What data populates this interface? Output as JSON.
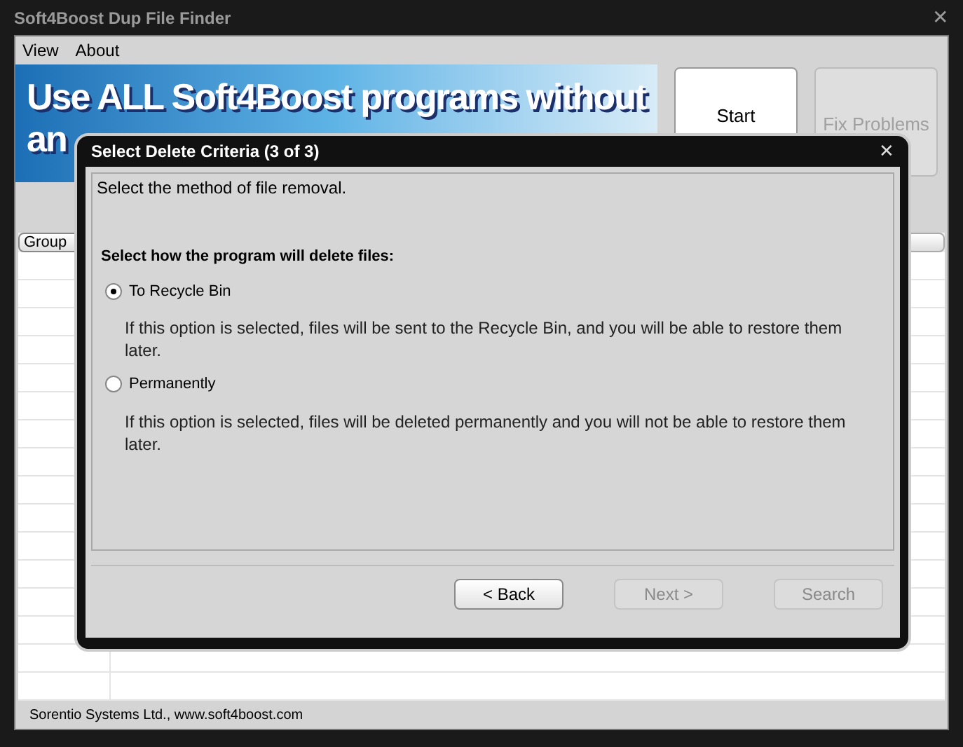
{
  "window": {
    "title": "Soft4Boost Dup File Finder",
    "close": "✕"
  },
  "menu": [
    {
      "label": "View"
    },
    {
      "label": "About"
    }
  ],
  "banner": {
    "lines": [
      "Use ALL Soft4Boost programs without",
      "an"
    ]
  },
  "toolbar": [
    {
      "label": "Start",
      "disabled": false
    },
    {
      "label": "Fix Problems",
      "disabled": true
    }
  ],
  "table": {
    "columns": [
      "Group"
    ]
  },
  "status_bar": "Sorentio Systems Ltd., www.soft4boost.com",
  "dialog": {
    "title": "Select Delete Criteria (3 of 3)",
    "close": "✕",
    "intro": "Select the method of file removal.",
    "heading": "Select how the program will delete files:",
    "options": [
      {
        "label": "To Recycle Bin",
        "selected": true,
        "description": "If this option is selected, files will be sent to the Recycle Bin, and you will be able to restore them later."
      },
      {
        "label": "Permanently",
        "selected": false,
        "description": "If this option is selected, files will be deleted permanently and you will not be able to restore them later."
      }
    ],
    "buttons": [
      {
        "label": "< Back",
        "disabled": false
      },
      {
        "label": "Next >",
        "disabled": true
      },
      {
        "label": "Search",
        "disabled": true
      }
    ]
  }
}
